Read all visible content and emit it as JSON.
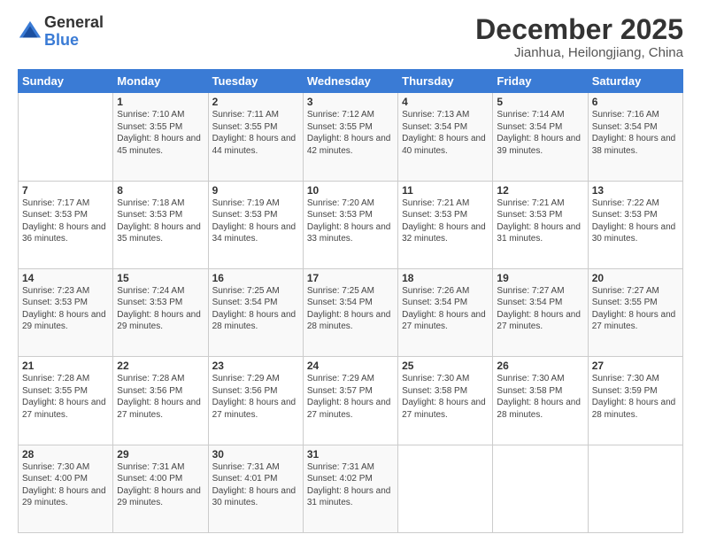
{
  "logo": {
    "general": "General",
    "blue": "Blue"
  },
  "title": "December 2025",
  "subtitle": "Jianhua, Heilongjiang, China",
  "days_of_week": [
    "Sunday",
    "Monday",
    "Tuesday",
    "Wednesday",
    "Thursday",
    "Friday",
    "Saturday"
  ],
  "weeks": [
    [
      {
        "day": "",
        "sunrise": "",
        "sunset": "",
        "daylight": ""
      },
      {
        "day": "1",
        "sunrise": "Sunrise: 7:10 AM",
        "sunset": "Sunset: 3:55 PM",
        "daylight": "Daylight: 8 hours and 45 minutes."
      },
      {
        "day": "2",
        "sunrise": "Sunrise: 7:11 AM",
        "sunset": "Sunset: 3:55 PM",
        "daylight": "Daylight: 8 hours and 44 minutes."
      },
      {
        "day": "3",
        "sunrise": "Sunrise: 7:12 AM",
        "sunset": "Sunset: 3:55 PM",
        "daylight": "Daylight: 8 hours and 42 minutes."
      },
      {
        "day": "4",
        "sunrise": "Sunrise: 7:13 AM",
        "sunset": "Sunset: 3:54 PM",
        "daylight": "Daylight: 8 hours and 40 minutes."
      },
      {
        "day": "5",
        "sunrise": "Sunrise: 7:14 AM",
        "sunset": "Sunset: 3:54 PM",
        "daylight": "Daylight: 8 hours and 39 minutes."
      },
      {
        "day": "6",
        "sunrise": "Sunrise: 7:16 AM",
        "sunset": "Sunset: 3:54 PM",
        "daylight": "Daylight: 8 hours and 38 minutes."
      }
    ],
    [
      {
        "day": "7",
        "sunrise": "Sunrise: 7:17 AM",
        "sunset": "Sunset: 3:53 PM",
        "daylight": "Daylight: 8 hours and 36 minutes."
      },
      {
        "day": "8",
        "sunrise": "Sunrise: 7:18 AM",
        "sunset": "Sunset: 3:53 PM",
        "daylight": "Daylight: 8 hours and 35 minutes."
      },
      {
        "day": "9",
        "sunrise": "Sunrise: 7:19 AM",
        "sunset": "Sunset: 3:53 PM",
        "daylight": "Daylight: 8 hours and 34 minutes."
      },
      {
        "day": "10",
        "sunrise": "Sunrise: 7:20 AM",
        "sunset": "Sunset: 3:53 PM",
        "daylight": "Daylight: 8 hours and 33 minutes."
      },
      {
        "day": "11",
        "sunrise": "Sunrise: 7:21 AM",
        "sunset": "Sunset: 3:53 PM",
        "daylight": "Daylight: 8 hours and 32 minutes."
      },
      {
        "day": "12",
        "sunrise": "Sunrise: 7:21 AM",
        "sunset": "Sunset: 3:53 PM",
        "daylight": "Daylight: 8 hours and 31 minutes."
      },
      {
        "day": "13",
        "sunrise": "Sunrise: 7:22 AM",
        "sunset": "Sunset: 3:53 PM",
        "daylight": "Daylight: 8 hours and 30 minutes."
      }
    ],
    [
      {
        "day": "14",
        "sunrise": "Sunrise: 7:23 AM",
        "sunset": "Sunset: 3:53 PM",
        "daylight": "Daylight: 8 hours and 29 minutes."
      },
      {
        "day": "15",
        "sunrise": "Sunrise: 7:24 AM",
        "sunset": "Sunset: 3:53 PM",
        "daylight": "Daylight: 8 hours and 29 minutes."
      },
      {
        "day": "16",
        "sunrise": "Sunrise: 7:25 AM",
        "sunset": "Sunset: 3:54 PM",
        "daylight": "Daylight: 8 hours and 28 minutes."
      },
      {
        "day": "17",
        "sunrise": "Sunrise: 7:25 AM",
        "sunset": "Sunset: 3:54 PM",
        "daylight": "Daylight: 8 hours and 28 minutes."
      },
      {
        "day": "18",
        "sunrise": "Sunrise: 7:26 AM",
        "sunset": "Sunset: 3:54 PM",
        "daylight": "Daylight: 8 hours and 27 minutes."
      },
      {
        "day": "19",
        "sunrise": "Sunrise: 7:27 AM",
        "sunset": "Sunset: 3:54 PM",
        "daylight": "Daylight: 8 hours and 27 minutes."
      },
      {
        "day": "20",
        "sunrise": "Sunrise: 7:27 AM",
        "sunset": "Sunset: 3:55 PM",
        "daylight": "Daylight: 8 hours and 27 minutes."
      }
    ],
    [
      {
        "day": "21",
        "sunrise": "Sunrise: 7:28 AM",
        "sunset": "Sunset: 3:55 PM",
        "daylight": "Daylight: 8 hours and 27 minutes."
      },
      {
        "day": "22",
        "sunrise": "Sunrise: 7:28 AM",
        "sunset": "Sunset: 3:56 PM",
        "daylight": "Daylight: 8 hours and 27 minutes."
      },
      {
        "day": "23",
        "sunrise": "Sunrise: 7:29 AM",
        "sunset": "Sunset: 3:56 PM",
        "daylight": "Daylight: 8 hours and 27 minutes."
      },
      {
        "day": "24",
        "sunrise": "Sunrise: 7:29 AM",
        "sunset": "Sunset: 3:57 PM",
        "daylight": "Daylight: 8 hours and 27 minutes."
      },
      {
        "day": "25",
        "sunrise": "Sunrise: 7:30 AM",
        "sunset": "Sunset: 3:58 PM",
        "daylight": "Daylight: 8 hours and 27 minutes."
      },
      {
        "day": "26",
        "sunrise": "Sunrise: 7:30 AM",
        "sunset": "Sunset: 3:58 PM",
        "daylight": "Daylight: 8 hours and 28 minutes."
      },
      {
        "day": "27",
        "sunrise": "Sunrise: 7:30 AM",
        "sunset": "Sunset: 3:59 PM",
        "daylight": "Daylight: 8 hours and 28 minutes."
      }
    ],
    [
      {
        "day": "28",
        "sunrise": "Sunrise: 7:30 AM",
        "sunset": "Sunset: 4:00 PM",
        "daylight": "Daylight: 8 hours and 29 minutes."
      },
      {
        "day": "29",
        "sunrise": "Sunrise: 7:31 AM",
        "sunset": "Sunset: 4:00 PM",
        "daylight": "Daylight: 8 hours and 29 minutes."
      },
      {
        "day": "30",
        "sunrise": "Sunrise: 7:31 AM",
        "sunset": "Sunset: 4:01 PM",
        "daylight": "Daylight: 8 hours and 30 minutes."
      },
      {
        "day": "31",
        "sunrise": "Sunrise: 7:31 AM",
        "sunset": "Sunset: 4:02 PM",
        "daylight": "Daylight: 8 hours and 31 minutes."
      },
      {
        "day": "",
        "sunrise": "",
        "sunset": "",
        "daylight": ""
      },
      {
        "day": "",
        "sunrise": "",
        "sunset": "",
        "daylight": ""
      },
      {
        "day": "",
        "sunrise": "",
        "sunset": "",
        "daylight": ""
      }
    ]
  ]
}
